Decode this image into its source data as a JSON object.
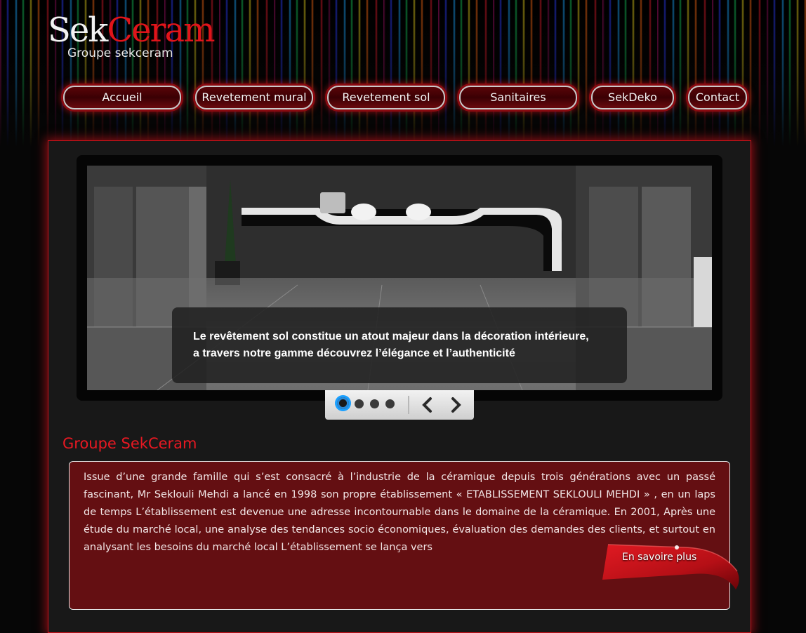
{
  "brand": {
    "name_part1": "Sek",
    "name_part2": "Ceram",
    "subtitle": "Groupe sekceram"
  },
  "nav": {
    "items": [
      {
        "label": "Accueil"
      },
      {
        "label": "Revetement mural"
      },
      {
        "label": "Revetement sol"
      },
      {
        "label": "Sanitaires"
      },
      {
        "label": "SekDeko"
      },
      {
        "label": "Contact"
      }
    ]
  },
  "slider": {
    "caption_line1": "Le revêtement sol constitue un atout majeur dans la décoration intérieure,",
    "caption_line2": "a travers notre gamme découvrez l’élégance et l’authenticité",
    "slide_count": 4,
    "active_slide": 1
  },
  "intro": {
    "title": "Groupe SekCeram",
    "body": "Issue d’une grande famille qui s’est consacré à l’industrie de la céramique depuis trois générations avec un passé fascinant, Mr Seklouli Mehdi a lancé en 1998 son propre établissement « ETABLISSEMENT SEKLOULI MEHDI » , en un laps de temps L’établissement est devenue une adresse incontournable dans le domaine de la céramique. En 2001, Après une étude du marché local, une analyse des tendances socio économiques, évaluation des demandes des clients, et surtout en analysant les besoins du marché local L’établissement se lança vers",
    "more_label": "En savoire plus"
  },
  "icons": {
    "prev": "chevron-left-icon",
    "next": "chevron-right-icon"
  },
  "colors": {
    "accent": "#e0141a",
    "panel_red": "#640f12",
    "background": "#060606"
  }
}
